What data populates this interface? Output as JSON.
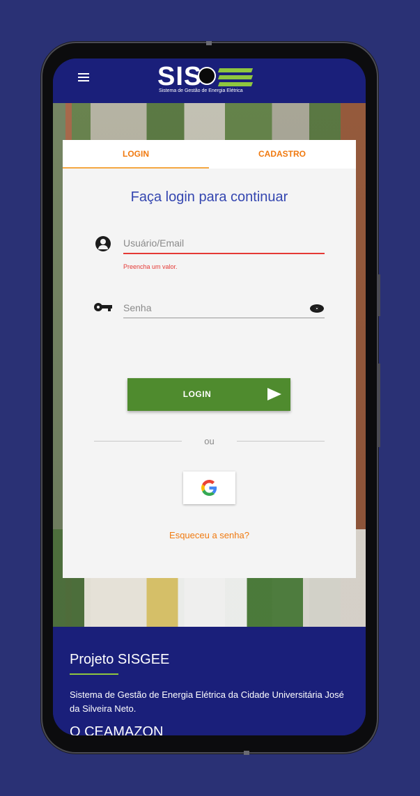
{
  "app": {
    "logo_text": "SIS",
    "logo_subtitle": "Sistema de Gestão de Energia Elétrica",
    "menu_icon": "menu-icon"
  },
  "tabs": [
    {
      "label": "LOGIN",
      "active": true
    },
    {
      "label": "CADASTRO",
      "active": false
    }
  ],
  "login_form": {
    "title": "Faça login para continuar",
    "user": {
      "placeholder": "Usuário/Email",
      "value": "",
      "icon": "account-circle-icon",
      "error": "Preencha um valor."
    },
    "password": {
      "placeholder": "Senha",
      "value": "",
      "icon": "key-icon",
      "visibility_icon": "eye-icon"
    },
    "submit_label": "LOGIN",
    "submit_icon": "send-icon",
    "divider_text": "ou",
    "google_icon": "google-icon",
    "forgot_label": "Esqueceu a senha?"
  },
  "footer": {
    "title": "Projeto SISGEE",
    "text": "Sistema de Gestão de Energia Elétrica da Cidade Universitária José da Silveira Neto.",
    "next_heading": "O CEAMAZON"
  },
  "colors": {
    "background": "#2a3175",
    "appbar": "#1a1f7a",
    "accent_orange": "#f07a10",
    "title_blue": "#3446b0",
    "button_green": "#4f8b2e",
    "error_red": "#e53935",
    "logo_green": "#8fc63f"
  }
}
